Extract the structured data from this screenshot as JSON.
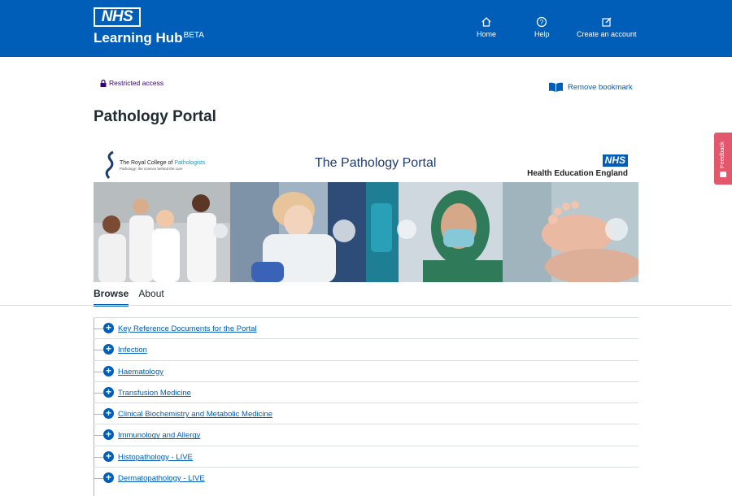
{
  "header": {
    "logo": "NHS",
    "app_name": "Learning Hub",
    "app_badge": "BETA",
    "nav": [
      {
        "label": "Home",
        "icon": "home-icon"
      },
      {
        "label": "Help",
        "icon": "help-icon"
      },
      {
        "label": "Create an account",
        "icon": "edit-icon"
      }
    ]
  },
  "restricted_label": "Restricted access",
  "bookmark_label": "Remove bookmark",
  "page_title": "Pathology Portal",
  "banner": {
    "rcp_name_a": "The Royal College of",
    "rcp_name_b": "Pathologists",
    "rcp_tagline": "Pathology: the science behind the cure",
    "portal_title": "The Pathology Portal",
    "hee_logo": "NHS",
    "hee_name": "Health Education England"
  },
  "tabs": [
    "Browse",
    "About"
  ],
  "tree_items": [
    "Key Reference Documents for the Portal",
    "Infection",
    "Haematology",
    "Transfusion Medicine",
    "Clinical Biochemistry and Metabolic Medicine",
    "Immunology and Allergy",
    "Histopathology - LIVE",
    "Dermatopathology - LIVE"
  ],
  "feedback_label": "Feedback",
  "colors": {
    "primary": "#005eb8",
    "text": "#212b32",
    "feedback": "#e4566c"
  }
}
